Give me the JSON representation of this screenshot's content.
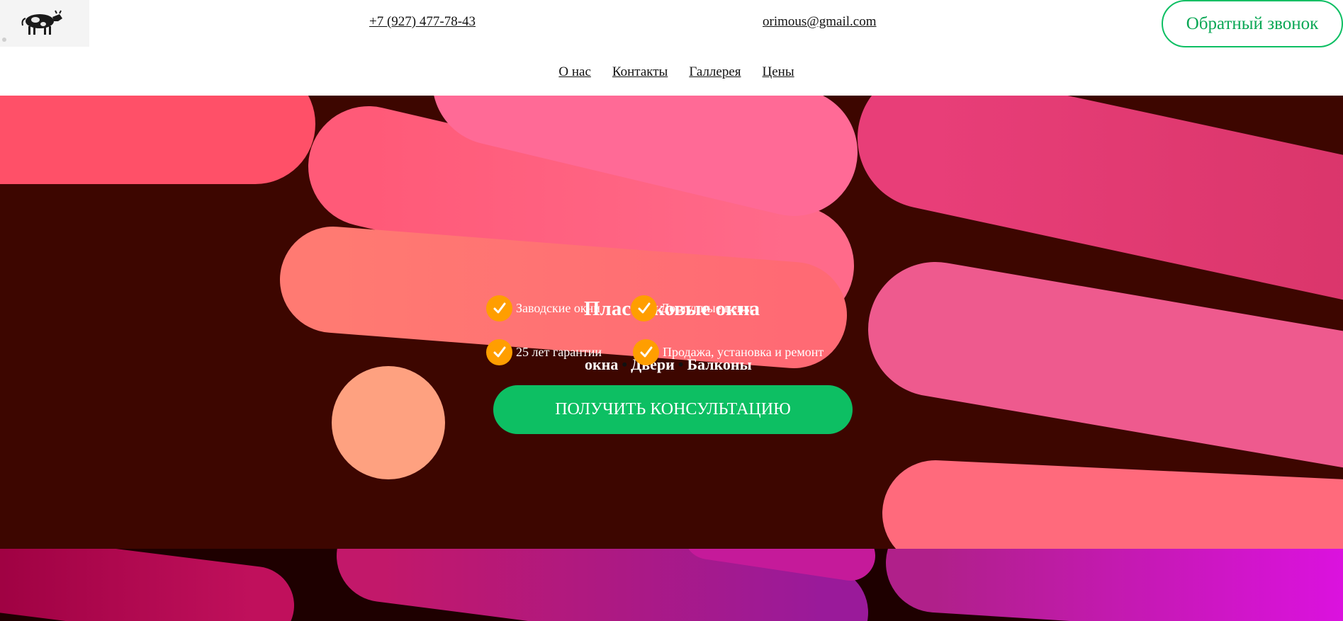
{
  "header": {
    "phone": "+7 (927) 477-78-43",
    "email": "orimous@gmail.com",
    "callback_label": "Обратный звонок",
    "logo_icon": "cow-icon"
  },
  "nav": {
    "items": [
      {
        "label": "О нас"
      },
      {
        "label": "Контакты"
      },
      {
        "label": "Галлерея"
      },
      {
        "label": "Цены"
      }
    ]
  },
  "hero": {
    "title": "Пластиковые окна",
    "services": [
      "окна",
      "Двери",
      "Балконы"
    ],
    "services_sep": "•",
    "features": [
      {
        "icon": "check-icon",
        "label": "Заводские окни"
      },
      {
        "icon": "check-icon",
        "label": "Доступные цены"
      },
      {
        "icon": "check-icon",
        "label": "25 лет гарантии"
      },
      {
        "icon": "check-icon",
        "label": "Продажа, установка и ремонт"
      }
    ],
    "cta_label": "ПОЛУЧИТЬ КОНСУЛЬТАЦИЮ"
  },
  "colors": {
    "accent_green": "#0dbf63",
    "check_orange": "#ff9e00",
    "hero_dark": "#3d0600"
  }
}
